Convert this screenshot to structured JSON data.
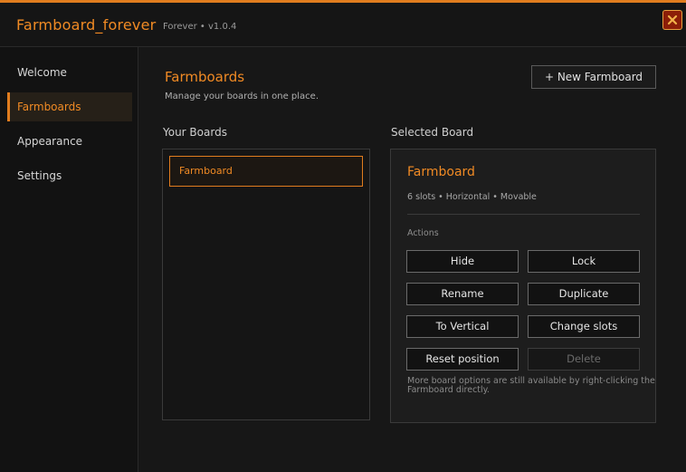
{
  "app": {
    "title": "Farmboard_forever",
    "version": "Forever • v1.0.4"
  },
  "colors": {
    "accent": "#f08a24",
    "close_bg": "#8c1e08"
  },
  "sidebar": {
    "items": [
      {
        "label": "Welcome",
        "active": false
      },
      {
        "label": "Farmboards",
        "active": true
      },
      {
        "label": "Appearance",
        "active": false
      },
      {
        "label": "Settings",
        "active": false
      }
    ]
  },
  "main": {
    "title": "Farmboards",
    "subtitle": "Manage your boards in one place.",
    "new_button": "+ New Farmboard",
    "boards_label": "Your Boards",
    "selected_label": "Selected Board",
    "boards": [
      {
        "name": "Farmboard",
        "selected": true
      }
    ],
    "selected": {
      "name": "Farmboard",
      "meta": "6 slots • Horizontal • Movable",
      "actions_label": "Actions",
      "actions": [
        {
          "label": "Hide",
          "enabled": true
        },
        {
          "label": "Lock",
          "enabled": true
        },
        {
          "label": "Rename",
          "enabled": true
        },
        {
          "label": "Duplicate",
          "enabled": true
        },
        {
          "label": "To Vertical",
          "enabled": true
        },
        {
          "label": "Change slots",
          "enabled": true
        },
        {
          "label": "Reset position",
          "enabled": true
        },
        {
          "label": "Delete",
          "enabled": false
        }
      ],
      "note": "More board options are still available by right-clicking the Farmboard directly."
    }
  }
}
